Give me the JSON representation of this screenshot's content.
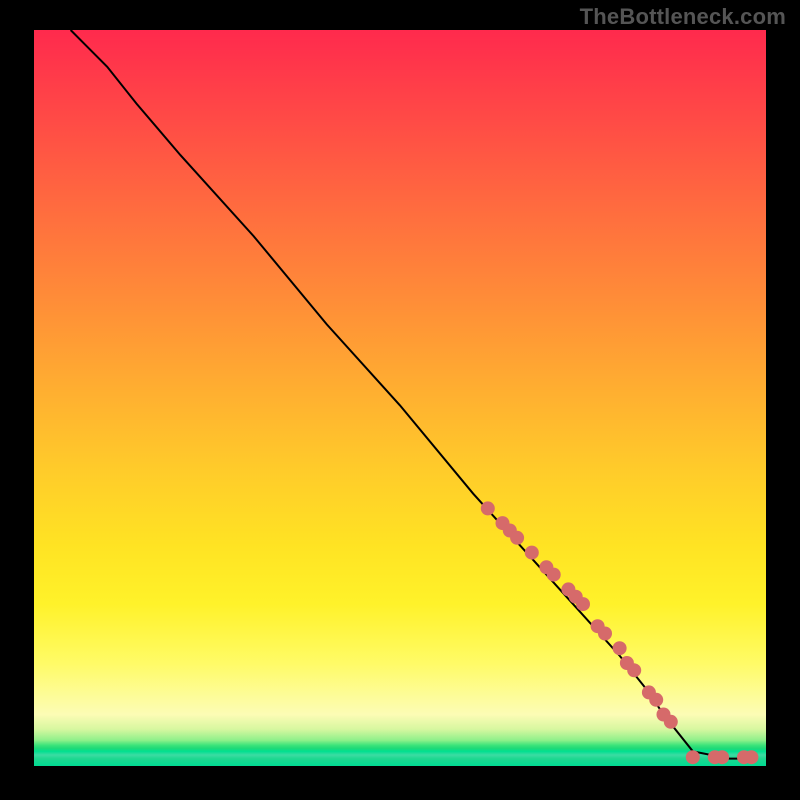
{
  "watermark": "TheBottleneck.com",
  "chart_data": {
    "type": "line",
    "title": "",
    "xlabel": "",
    "ylabel": "",
    "xlim": [
      0,
      100
    ],
    "ylim": [
      0,
      100
    ],
    "grid": false,
    "series": [
      {
        "name": "curve",
        "color": "#000000",
        "x": [
          5,
          7,
          10,
          14,
          20,
          30,
          40,
          50,
          60,
          70,
          80,
          84,
          86,
          90,
          95,
          98
        ],
        "y": [
          100,
          98,
          95,
          90,
          83,
          72,
          60,
          49,
          37,
          26,
          15,
          10,
          7,
          2,
          1,
          1
        ]
      }
    ],
    "points": {
      "name": "markers",
      "color": "#d66a6a",
      "x": [
        62,
        64,
        65,
        66,
        68,
        70,
        71,
        73,
        74,
        75,
        77,
        78,
        80,
        81,
        82,
        84,
        85,
        86,
        87,
        90,
        93,
        94,
        97,
        98
      ],
      "y": [
        35,
        33,
        32,
        31,
        29,
        27,
        26,
        24,
        23,
        22,
        19,
        18,
        16,
        14,
        13,
        10,
        9,
        7,
        6,
        1.2,
        1.2,
        1.2,
        1.2,
        1.2
      ]
    }
  }
}
